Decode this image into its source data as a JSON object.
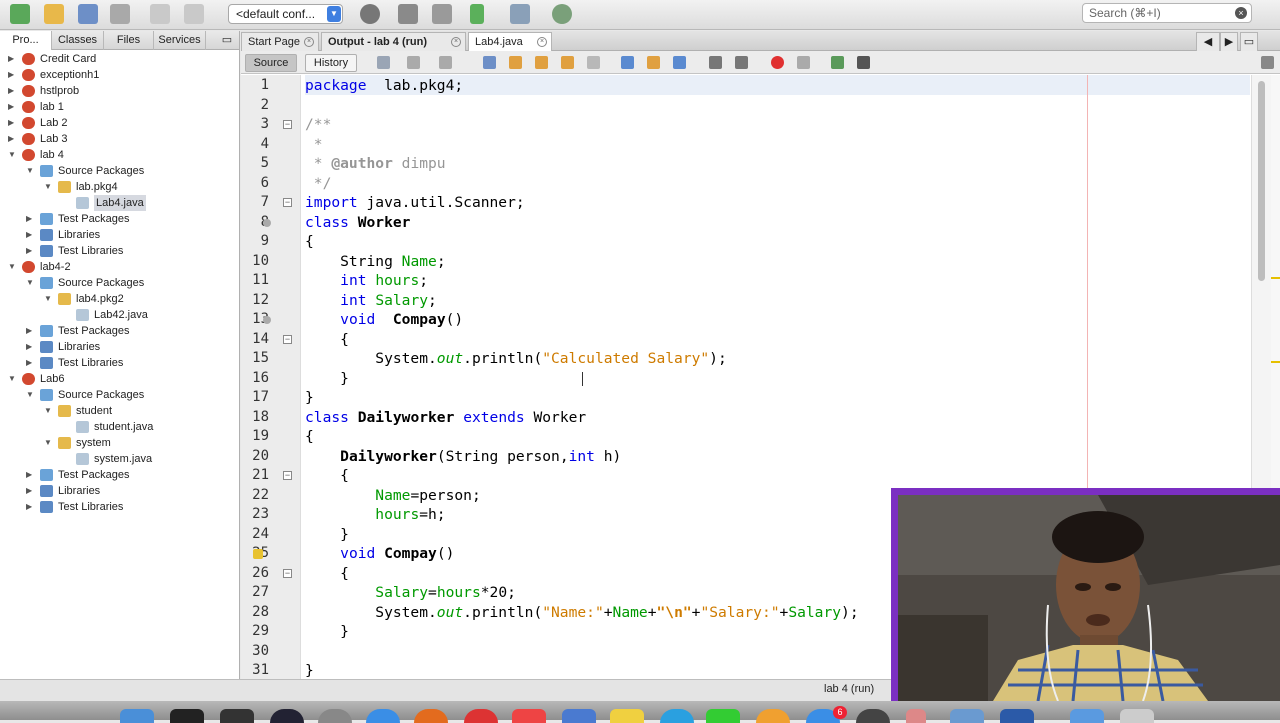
{
  "toolbar": {
    "config_value": "<default conf...",
    "search_placeholder": "Search (⌘+I)"
  },
  "left_panel": {
    "tabs": [
      "Pro...",
      "Classes",
      "Files",
      "Services"
    ],
    "tree": [
      {
        "label": "Credit Card",
        "level": 0,
        "icon": "project-icon",
        "state": "collapsed"
      },
      {
        "label": "exceptionh1",
        "level": 0,
        "icon": "project-icon",
        "state": "collapsed"
      },
      {
        "label": "hstlprob",
        "level": 0,
        "icon": "project-icon",
        "state": "collapsed"
      },
      {
        "label": "lab 1",
        "level": 0,
        "icon": "project-icon",
        "state": "collapsed"
      },
      {
        "label": "Lab 2",
        "level": 0,
        "icon": "project-icon",
        "state": "collapsed"
      },
      {
        "label": "Lab 3",
        "level": 0,
        "icon": "project-icon",
        "state": "collapsed"
      },
      {
        "label": "lab 4",
        "level": 0,
        "icon": "project-icon",
        "state": "expanded"
      },
      {
        "label": "Source Packages",
        "level": 1,
        "icon": "source-packages-icon",
        "state": "expanded"
      },
      {
        "label": "lab.pkg4",
        "level": 2,
        "icon": "package-icon",
        "state": "expanded"
      },
      {
        "label": "Lab4.java",
        "level": 3,
        "icon": "java-file-icon",
        "state": "leaf",
        "selected": true
      },
      {
        "label": "Test Packages",
        "level": 1,
        "icon": "test-packages-icon",
        "state": "collapsed"
      },
      {
        "label": "Libraries",
        "level": 1,
        "icon": "libraries-icon",
        "state": "collapsed"
      },
      {
        "label": "Test Libraries",
        "level": 1,
        "icon": "test-libraries-icon",
        "state": "collapsed"
      },
      {
        "label": "lab4-2",
        "level": 0,
        "icon": "project-icon",
        "state": "expanded"
      },
      {
        "label": "Source Packages",
        "level": 1,
        "icon": "source-packages-icon",
        "state": "expanded"
      },
      {
        "label": "lab4.pkg2",
        "level": 2,
        "icon": "package-icon",
        "state": "expanded"
      },
      {
        "label": "Lab42.java",
        "level": 3,
        "icon": "java-file-icon",
        "state": "leaf"
      },
      {
        "label": "Test Packages",
        "level": 1,
        "icon": "test-packages-icon",
        "state": "collapsed"
      },
      {
        "label": "Libraries",
        "level": 1,
        "icon": "libraries-icon",
        "state": "collapsed"
      },
      {
        "label": "Test Libraries",
        "level": 1,
        "icon": "test-libraries-icon",
        "state": "collapsed"
      },
      {
        "label": "Lab6",
        "level": 0,
        "icon": "project-icon",
        "state": "expanded"
      },
      {
        "label": "Source Packages",
        "level": 1,
        "icon": "source-packages-icon",
        "state": "expanded"
      },
      {
        "label": "student",
        "level": 2,
        "icon": "package-icon",
        "state": "expanded"
      },
      {
        "label": "student.java",
        "level": 3,
        "icon": "java-file-icon",
        "state": "leaf"
      },
      {
        "label": "system",
        "level": 2,
        "icon": "package-icon",
        "state": "expanded"
      },
      {
        "label": "system.java",
        "level": 3,
        "icon": "java-file-icon",
        "state": "leaf"
      },
      {
        "label": "Test Packages",
        "level": 1,
        "icon": "test-packages-icon",
        "state": "collapsed"
      },
      {
        "label": "Libraries",
        "level": 1,
        "icon": "libraries-icon",
        "state": "collapsed"
      },
      {
        "label": "Test Libraries",
        "level": 1,
        "icon": "test-libraries-icon",
        "state": "collapsed"
      }
    ]
  },
  "editor": {
    "tabs": [
      {
        "label": "Start Page",
        "active": false
      },
      {
        "label": "Output - lab 4 (run)",
        "active": false
      },
      {
        "label": "Lab4.java",
        "active": true
      }
    ],
    "source_label": "Source",
    "history_label": "History",
    "code_lines": [
      [
        [
          "kw",
          "package"
        ],
        [
          "",
          "  lab.pkg4;"
        ]
      ],
      [],
      [
        [
          "cm",
          "/**"
        ]
      ],
      [
        [
          "cm",
          " *"
        ]
      ],
      [
        [
          "cm",
          " * "
        ],
        [
          "ann",
          "@author"
        ],
        [
          "cm",
          " dimpu"
        ]
      ],
      [
        [
          "cm",
          " */"
        ]
      ],
      [
        [
          "kw",
          "import"
        ],
        [
          "",
          " java.util.Scanner;"
        ]
      ],
      [
        [
          "kw",
          "class"
        ],
        [
          "",
          " "
        ],
        [
          "b",
          "Worker"
        ]
      ],
      [
        [
          "",
          "{"
        ]
      ],
      [
        [
          "",
          "    String "
        ],
        [
          "fld",
          "Name"
        ],
        [
          "",
          ";"
        ]
      ],
      [
        [
          "",
          "    "
        ],
        [
          "kw",
          "int"
        ],
        [
          "",
          " "
        ],
        [
          "fld",
          "hours"
        ],
        [
          "",
          ";"
        ]
      ],
      [
        [
          "",
          "    "
        ],
        [
          "kw",
          "int"
        ],
        [
          "",
          " "
        ],
        [
          "fld",
          "Salary"
        ],
        [
          "",
          ";"
        ]
      ],
      [
        [
          "",
          "    "
        ],
        [
          "kw",
          "void"
        ],
        [
          "",
          "  "
        ],
        [
          "b",
          "Compay"
        ],
        [
          "",
          "()"
        ]
      ],
      [
        [
          "",
          "    {"
        ]
      ],
      [
        [
          "",
          "        System."
        ],
        [
          "fld it",
          "out"
        ],
        [
          "",
          ".println("
        ],
        [
          "st",
          "\"Calculated Salary\""
        ],
        [
          "",
          ");"
        ]
      ],
      [
        [
          "",
          "    }"
        ]
      ],
      [
        [
          "",
          "}"
        ]
      ],
      [
        [
          "kw",
          "class"
        ],
        [
          "",
          " "
        ],
        [
          "b",
          "Dailyworker"
        ],
        [
          "",
          " "
        ],
        [
          "kw",
          "extends"
        ],
        [
          "",
          " Worker"
        ]
      ],
      [
        [
          "",
          "{"
        ]
      ],
      [
        [
          "",
          "    "
        ],
        [
          "b",
          "Dailyworker"
        ],
        [
          "",
          "(String person,"
        ],
        [
          "kw",
          "int"
        ],
        [
          "",
          " h)"
        ]
      ],
      [
        [
          "",
          "    {"
        ]
      ],
      [
        [
          "",
          "        "
        ],
        [
          "fld",
          "Name"
        ],
        [
          "",
          "=person;"
        ]
      ],
      [
        [
          "",
          "        "
        ],
        [
          "fld",
          "hours"
        ],
        [
          "",
          "=h;"
        ]
      ],
      [
        [
          "",
          "    }"
        ]
      ],
      [
        [
          "",
          "    "
        ],
        [
          "kw",
          "void"
        ],
        [
          "",
          " "
        ],
        [
          "b",
          "Compay"
        ],
        [
          "",
          "()"
        ]
      ],
      [
        [
          "",
          "    {"
        ]
      ],
      [
        [
          "",
          "        "
        ],
        [
          "fld",
          "Salary"
        ],
        [
          "",
          "="
        ],
        [
          "fld",
          "hours"
        ],
        [
          "",
          "*20;"
        ]
      ],
      [
        [
          "",
          "        System."
        ],
        [
          "fld it",
          "out"
        ],
        [
          "",
          ".println("
        ],
        [
          "st",
          "\"Name:\""
        ],
        [
          "",
          "+"
        ],
        [
          "fld",
          "Name"
        ],
        [
          "",
          "+"
        ],
        [
          "st b",
          "\"\\n\""
        ],
        [
          "",
          "+"
        ],
        [
          "st",
          "\"Salary:\""
        ],
        [
          "",
          "+"
        ],
        [
          "fld",
          "Salary"
        ],
        [
          "",
          ");"
        ]
      ],
      [
        [
          "",
          "    }"
        ]
      ],
      [],
      [
        [
          "",
          "}"
        ]
      ]
    ]
  },
  "statusbar": {
    "run_status": "lab 4 (run)"
  },
  "dock": {
    "badge_count": "6"
  },
  "colors": {
    "keyword": "#0000e6",
    "field": "#009900",
    "string": "#ce7b00",
    "comment": "#969696",
    "webcam_border": "#7b2fc2"
  }
}
